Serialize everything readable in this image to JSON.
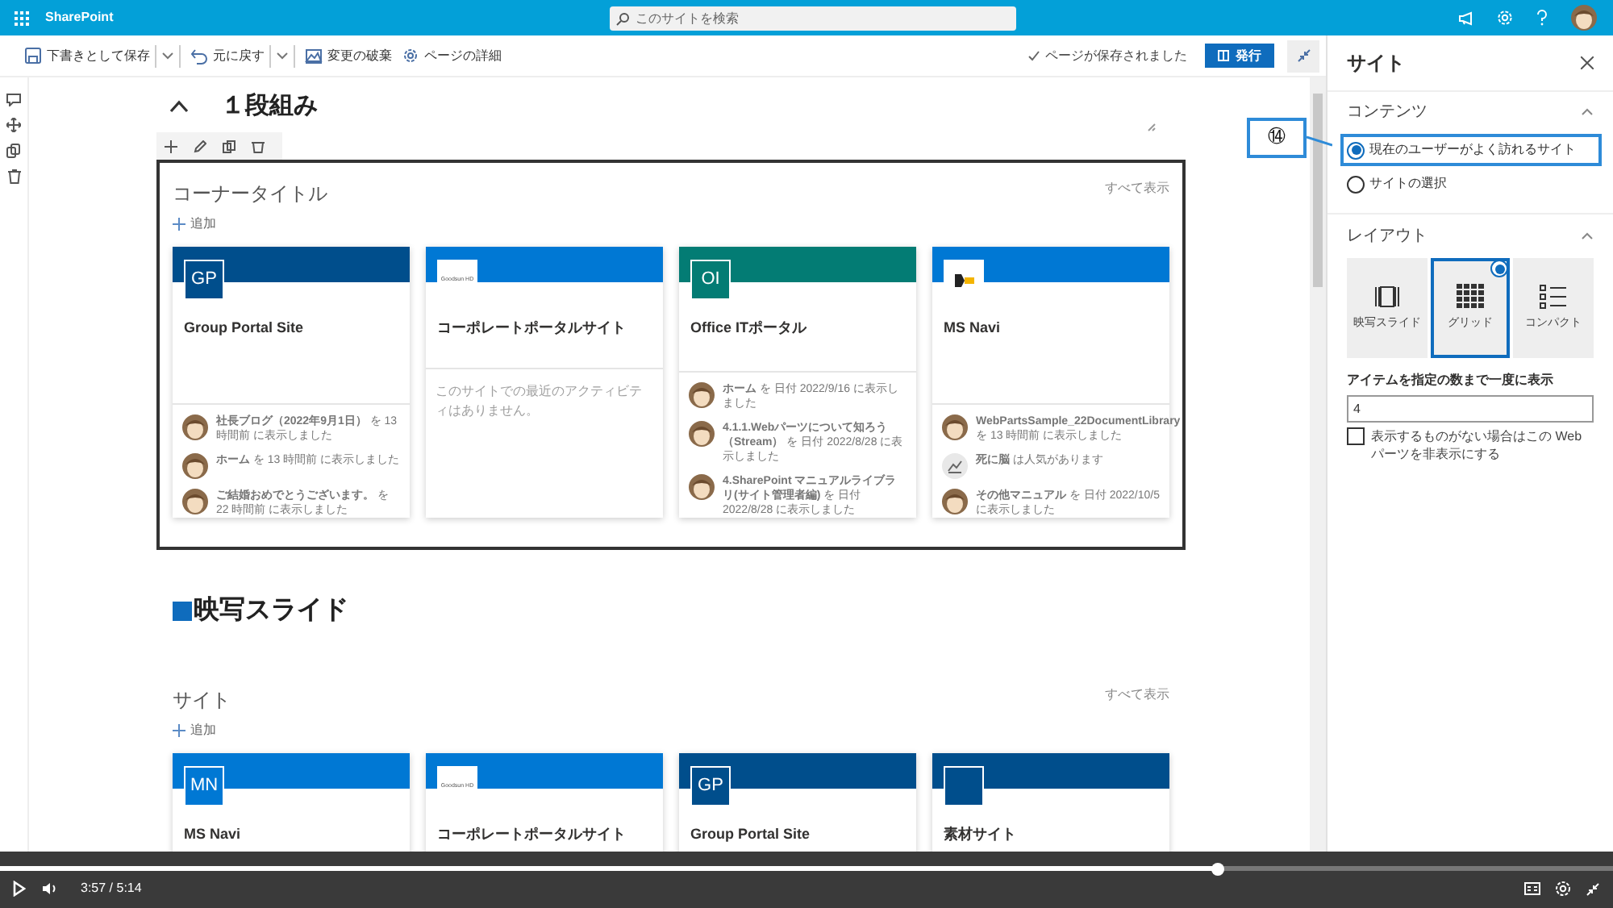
{
  "app_bar": {
    "app_name": "SharePoint",
    "search_placeholder": "このサイトを検索"
  },
  "command_bar": {
    "items": [
      {
        "label": "下書きとして保存",
        "kind": "save",
        "split": true
      },
      {
        "label": "元に戻す",
        "kind": "undo",
        "split": true
      },
      {
        "label": "変更の破棄",
        "kind": "discard",
        "split": false
      },
      {
        "label": "ページの詳細",
        "kind": "details",
        "split": false
      }
    ],
    "status": "ページが保存されました",
    "publish": "発行"
  },
  "section": {
    "title": "１段組み"
  },
  "webparts": [
    {
      "title": "コーナータイトル",
      "add": "追加",
      "see_all": "すべて表示",
      "selected": true,
      "cards": [
        {
          "logo": {
            "kind": "initials",
            "text": "GP"
          },
          "color": "#004e8c",
          "name": "Group Portal Site",
          "activities": [
            {
              "kind": "person",
              "text": "**社長ブログ（2022年9月1日）** を 13 時間前 に表示しました"
            },
            {
              "kind": "person",
              "text": "**ホーム** を 13 時間前 に表示しました"
            },
            {
              "kind": "person",
              "text": "**ご結婚おめでとうございます。** を 22 時間前 に表示しました"
            }
          ]
        },
        {
          "logo": {
            "kind": "text",
            "text": "Goodsun HD"
          },
          "color": "#0078d4",
          "name": "コーポレートポータルサイト",
          "empty_text": "このサイトでの最近のアクティビティはありません。"
        },
        {
          "logo": {
            "kind": "initials",
            "text": "OI"
          },
          "color": "#037c74",
          "name": "Office ITポータル",
          "activities": [
            {
              "kind": "person",
              "text": "**ホーム** を 日付 2022/9/16 に表示しました"
            },
            {
              "kind": "person",
              "text": "**4.1.1.Webパーツについて知ろう（Stream）** を 日付 2022/8/28 に表示しました"
            },
            {
              "kind": "person",
              "text": "**4.SharePoint マニュアルライブラリ(サイト管理者編)** を 日付 2022/8/28 に表示しました"
            }
          ]
        },
        {
          "logo": {
            "kind": "mark"
          },
          "color": "#0078d4",
          "name": "MS Navi",
          "activities": [
            {
              "kind": "person",
              "text": "**WebPartsSample_22DocumentLibrary** を 13 時間前 に表示しました"
            },
            {
              "kind": "trending",
              "text": "**死に脳** は人気があります"
            },
            {
              "kind": "person",
              "text": "**その他マニュアル** を 日付 2022/10/5 に表示しました"
            }
          ]
        }
      ]
    },
    {
      "heading": "映写スライド",
      "title": "サイト",
      "add": "追加",
      "see_all": "すべて表示",
      "selected": false,
      "cards": [
        {
          "logo": {
            "kind": "initials",
            "text": "MN"
          },
          "color": "#0078d4",
          "name": "MS Navi"
        },
        {
          "logo": {
            "kind": "text",
            "text": "Goodsun HD"
          },
          "color": "#0078d4",
          "name": "コーポレートポータルサイト"
        },
        {
          "logo": {
            "kind": "initials",
            "text": "GP"
          },
          "color": "#004e8c",
          "name": "Group Portal Site"
        },
        {
          "logo": {
            "kind": "blank"
          },
          "color": "#004e8c",
          "name": "素材サイト"
        }
      ]
    }
  ],
  "panel": {
    "title": "サイト",
    "contents": {
      "header": "コンテンツ",
      "options": [
        {
          "label": "現在のユーザーがよく訪れるサイト",
          "selected": true,
          "highlighted": true
        },
        {
          "label": "サイトの選択",
          "selected": false,
          "highlighted": false
        }
      ]
    },
    "layout": {
      "header": "レイアウト",
      "options": [
        {
          "label": "映写スライド",
          "kind": "filmstrip",
          "selected": false
        },
        {
          "label": "グリッド",
          "kind": "grid",
          "selected": true
        },
        {
          "label": "コンパクト",
          "kind": "compact",
          "selected": false
        }
      ]
    },
    "count_label": "アイテムを指定の数まで一度に表示",
    "count_value": "4",
    "hide_when_empty": {
      "label": "表示するものがない場合はこの Web パーツを非表示にする",
      "checked": false
    }
  },
  "callout": {
    "text": "⑭"
  },
  "player": {
    "time": "3:57 / 5:14",
    "level": 0.755
  }
}
